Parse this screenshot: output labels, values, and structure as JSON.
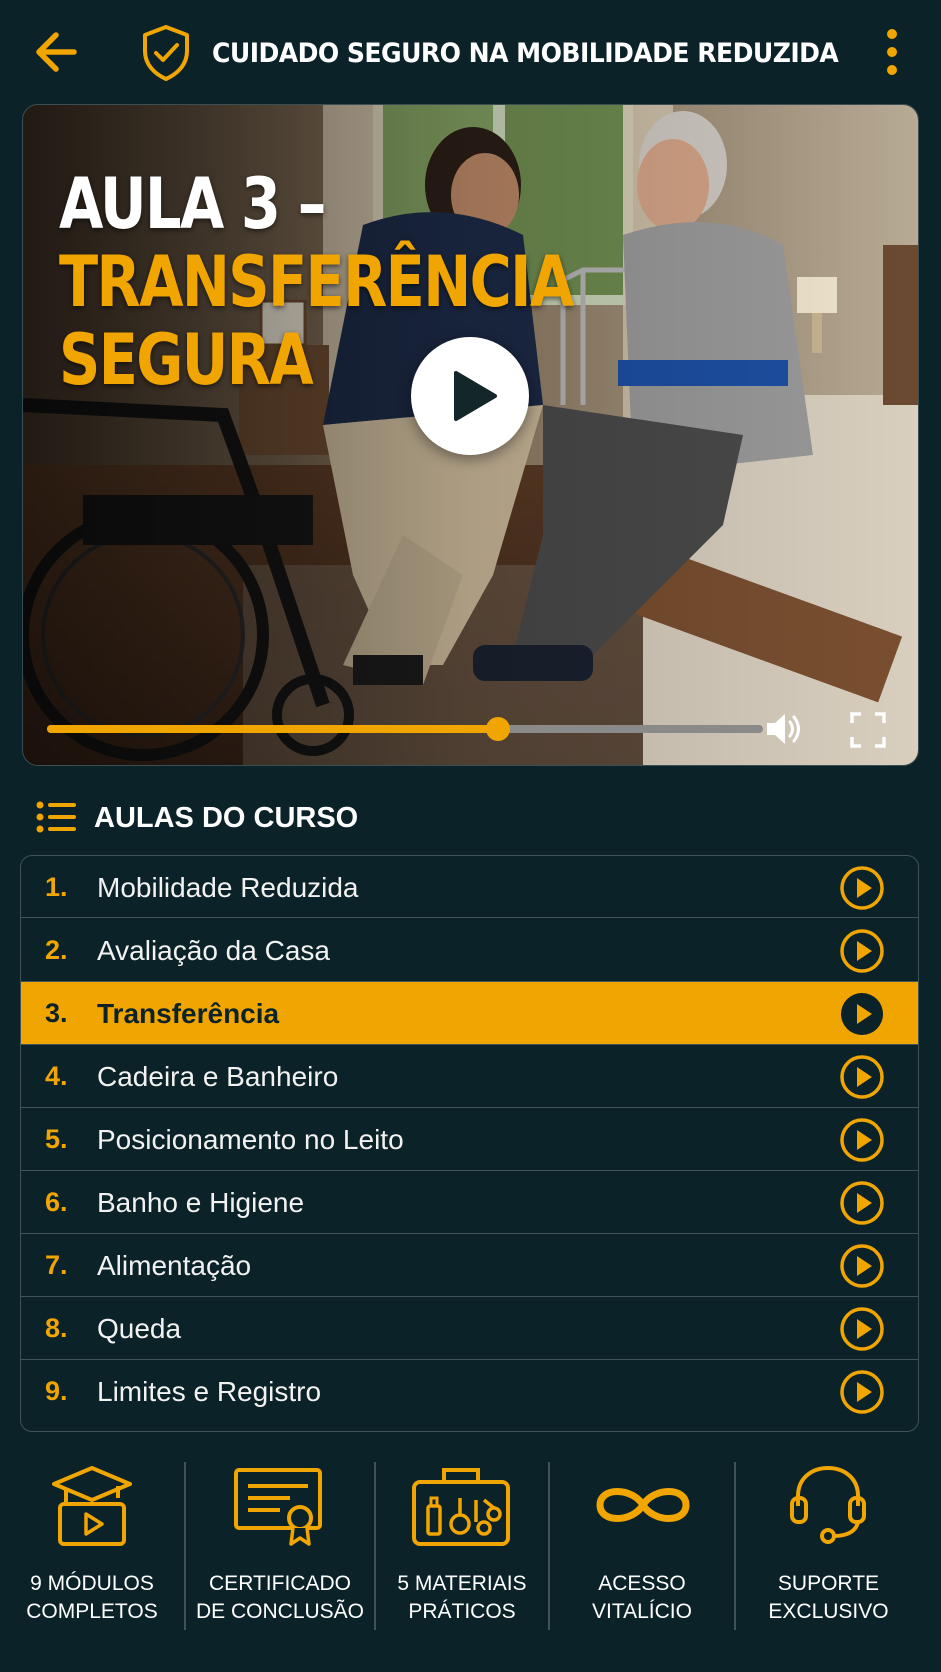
{
  "header": {
    "title": "CUIDADO SEGURO NA MOBILIDADE REDUZIDA",
    "back_icon": "arrow-left-icon",
    "logo_icon": "shield-check-icon",
    "menu_icon": "kebab-menu-icon"
  },
  "video": {
    "title_line1": "AULA 3 –",
    "title_line2": "TRANSFERÊNCIA",
    "title_line3": "SEGURA",
    "progress_fraction": 0.63,
    "play_icon": "play-icon",
    "volume_icon": "volume-icon",
    "fullscreen_icon": "fullscreen-icon"
  },
  "lessons": {
    "section_title": "AULAS DO CURSO",
    "section_icon": "list-icon",
    "active_index": 2,
    "items": [
      {
        "num": "1.",
        "label": "Mobilidade Reduzida"
      },
      {
        "num": "2.",
        "label": "Avaliação da Casa"
      },
      {
        "num": "3.",
        "label": "Transferência"
      },
      {
        "num": "4.",
        "label": "Cadeira e Banheiro"
      },
      {
        "num": "5.",
        "label": "Posicionamento no Leito"
      },
      {
        "num": "6.",
        "label": "Banho e Higiene"
      },
      {
        "num": "7.",
        "label": "Alimentação"
      },
      {
        "num": "8.",
        "label": "Queda"
      },
      {
        "num": "9.",
        "label": "Limites e Registro"
      }
    ]
  },
  "features": [
    {
      "line1": "9 MÓDULOS",
      "line2": "COMPLETOS",
      "icon": "graduation-video-icon"
    },
    {
      "line1": "CERTIFICADO",
      "line2": "DE CONCLUSÃO",
      "icon": "certificate-icon"
    },
    {
      "line1": "5 MATERIAIS",
      "line2": "PRÁTICOS",
      "icon": "medical-kit-icon"
    },
    {
      "line1": "ACESSO",
      "line2": "VITALÍCIO",
      "icon": "infinity-icon"
    },
    {
      "line1": "SUPORTE",
      "line2": "EXCLUSIVO",
      "icon": "headset-icon"
    }
  ],
  "colors": {
    "background": "#0b2228",
    "accent": "#f0a500",
    "text": "#ffffff",
    "border": "#3f5359"
  }
}
